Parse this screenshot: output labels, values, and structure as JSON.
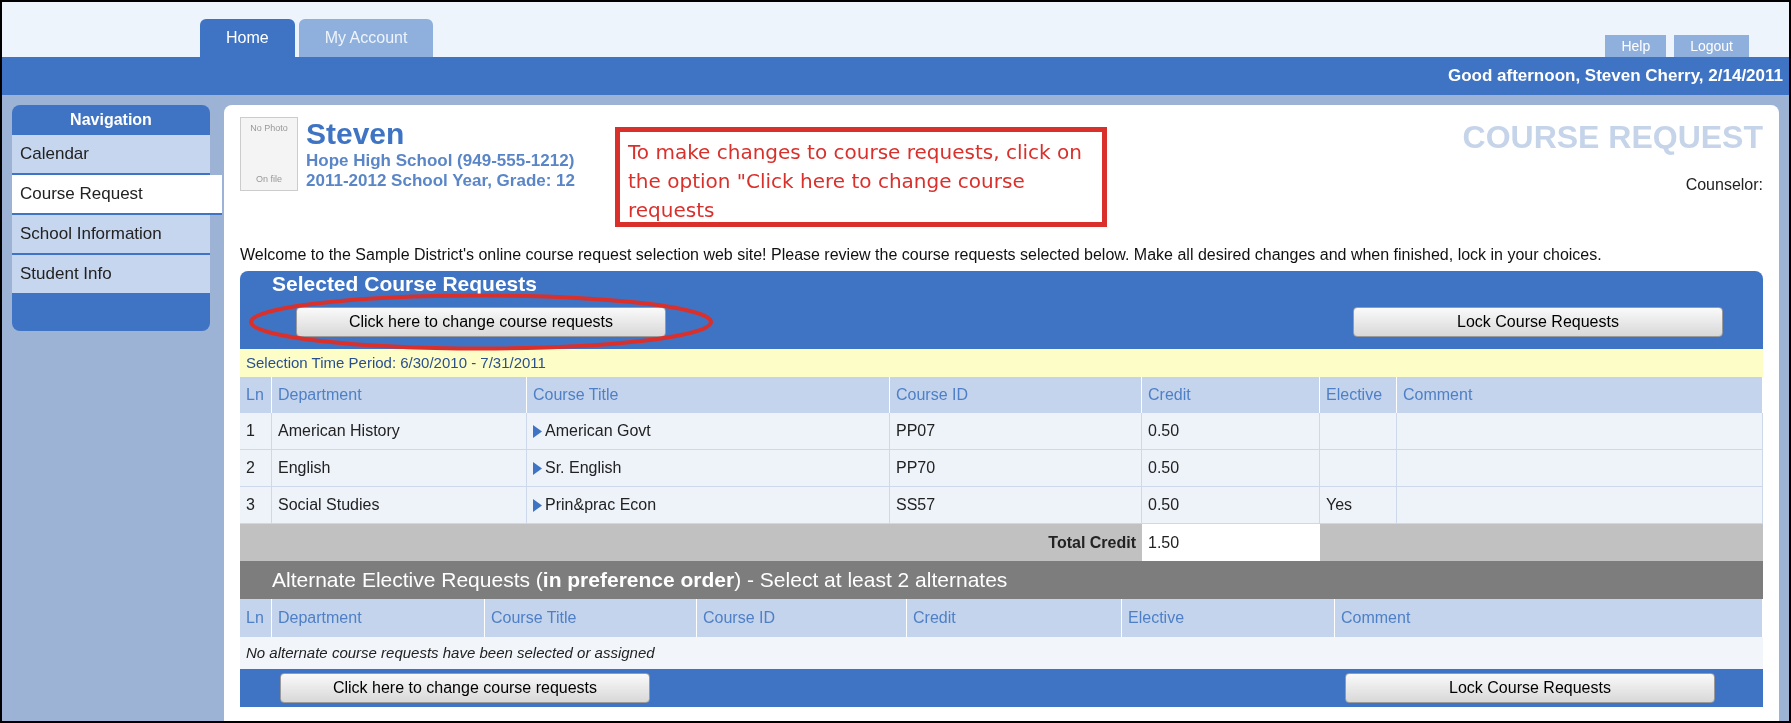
{
  "top_tabs": [
    {
      "label": "Home",
      "selected": true
    },
    {
      "label": "My Account",
      "selected": false
    }
  ],
  "header_links": [
    "Help",
    "Logout"
  ],
  "greeting": "Good afternoon, Steven Cherry, 2/14/2011",
  "sidebar": {
    "title": "Navigation",
    "items": [
      {
        "label": "Calendar",
        "selected": false
      },
      {
        "label": "Course Request",
        "selected": true
      },
      {
        "label": "School Information",
        "selected": false
      },
      {
        "label": "Student Info",
        "selected": false
      }
    ]
  },
  "student": {
    "photo_text": [
      "No Photo",
      "On file"
    ],
    "name": "Steven",
    "school": "Hope High School (949-555-1212)",
    "year": "2011-2012 School Year, Grade: 12"
  },
  "annotation": "To make changes to course requests, click on the option \"Click here to change course requests",
  "page_title": "COURSE REQUEST",
  "counselor": "Counselor:",
  "welcome": "Welcome to the Sample District's online course request selection web site! Please review the course requests selected below. Make all desired changes and when finished, lock in your choices.",
  "selected": {
    "title": "Selected Course Requests",
    "buttons": [
      "Click here to change course requests",
      "Lock Course Requests"
    ],
    "period": "Selection Time Period: 6/30/2010 - 7/31/2011",
    "columns": [
      "Ln",
      "Department",
      "Course Title",
      "Course ID",
      "Credit",
      "Elective",
      "Comment"
    ],
    "rows": [
      {
        "ln": "1",
        "department": "American History",
        "title": "American Govt",
        "id": "PP07",
        "credit": "0.50",
        "elective": ""
      },
      {
        "ln": "2",
        "department": "English",
        "title": "Sr. English",
        "id": "PP70",
        "credit": "0.50",
        "elective": ""
      },
      {
        "ln": "3",
        "department": "Social Studies",
        "title": "Prin&prac Econ",
        "id": "SS57",
        "credit": "0.50",
        "elective": "Yes"
      }
    ],
    "total_label": "Total Credit",
    "total": "1.50"
  },
  "alternate": {
    "title": "Alternate Elective Requests (**in preference order**) - Select at least 2 alternates",
    "columns": [
      "Ln",
      "Department",
      "Course Title",
      "Course ID",
      "Credit",
      "Elective",
      "Comment"
    ],
    "empty": "No alternate course requests have been selected or assigned",
    "buttons": [
      "Click here to change course requests",
      "Lock Course Requests"
    ]
  }
}
